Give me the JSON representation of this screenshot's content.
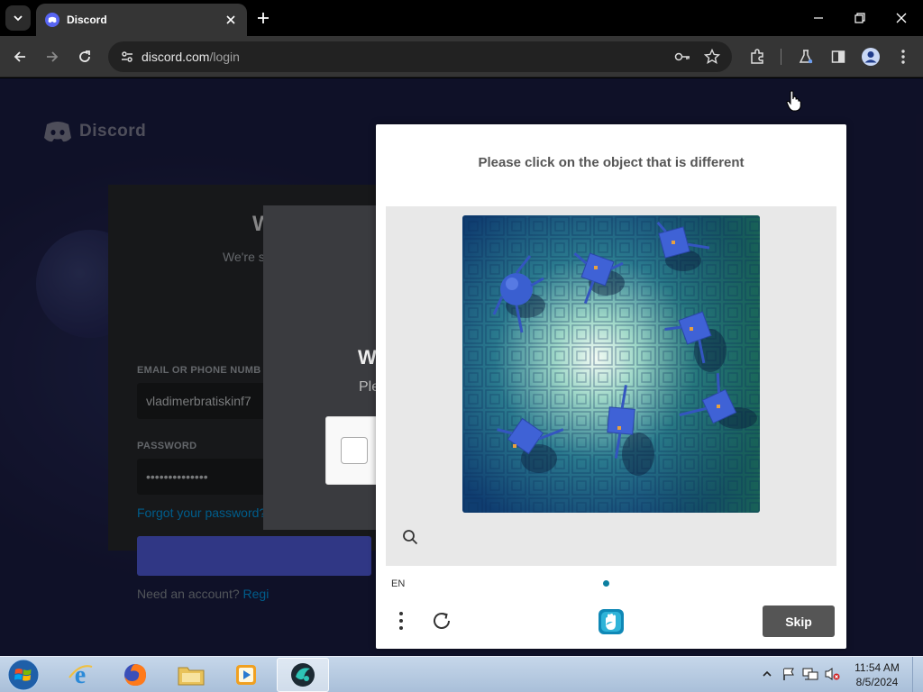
{
  "browser": {
    "tab": {
      "title": "Discord",
      "favicon": "discord-icon"
    },
    "address": {
      "host": "discord.com",
      "path": "/login"
    },
    "icons": [
      "tab-list-icon",
      "close-icon",
      "plus-icon",
      "minimize-icon",
      "restore-icon",
      "back-icon",
      "forward-icon",
      "reload-icon",
      "site-settings-icon",
      "key-icon",
      "star-icon",
      "extensions-icon",
      "labs-icon",
      "side-panel-icon",
      "profile-icon",
      "menu-kebab-icon"
    ]
  },
  "page": {
    "logo_text": "Discord",
    "login": {
      "title": "W",
      "subtitle": "We're s",
      "email_label": "EMAIL OR PHONE NUMB",
      "email_value": "vladimerbratiskinf7",
      "password_label": "PASSWORD",
      "password_value": "••••••••••••••",
      "forgot": "Forgot your password?",
      "register_prompt": "Need an account?",
      "register_link": "Regi"
    },
    "verify": {
      "title": "W",
      "subtitle": "Ple"
    }
  },
  "captcha": {
    "prompt": "Please click on the object that is different",
    "image_description_icon": "challenge-image",
    "language": "EN",
    "skip_label": "Skip",
    "colors": {
      "accent": "#0c7fa0",
      "skip_bg": "#555555"
    }
  },
  "taskbar": {
    "items": [
      "internet-explorer-icon",
      "firefox-icon",
      "file-explorer-icon",
      "media-player-icon",
      "app-icon"
    ],
    "clock_time": "11:54 AM",
    "clock_date": "8/5/2024"
  }
}
